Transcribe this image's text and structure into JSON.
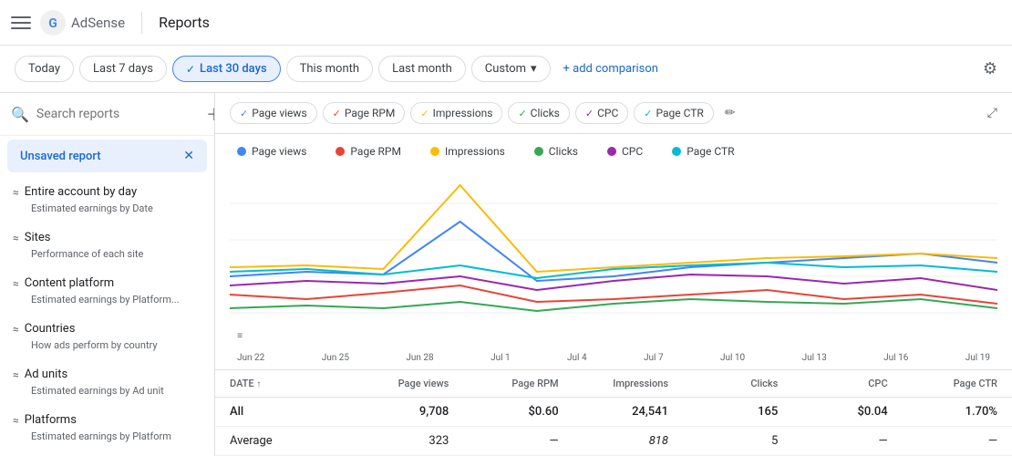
{
  "header": {
    "menu_icon": "☰",
    "logo_alt": "Google AdSense",
    "divider": true,
    "page_title": "Reports"
  },
  "filters": {
    "today": "Today",
    "last7": "Last 7 days",
    "last30": "Last 30 days",
    "thismonth": "This month",
    "lastmonth": "Last month",
    "custom": "Custom",
    "custom_arrow": "▾",
    "add_comparison": "+ add comparison"
  },
  "sidebar": {
    "search_placeholder": "Search reports",
    "unsaved_label": "Unsaved report",
    "items": [
      {
        "id": "entire-account",
        "title": "Entire account by day",
        "subtitle": "Estimated earnings by Date",
        "icon": "≈"
      },
      {
        "id": "sites",
        "title": "Sites",
        "subtitle": "Performance of each site",
        "icon": "≈"
      },
      {
        "id": "content-platform",
        "title": "Content platform",
        "subtitle": "Estimated earnings by Platform...",
        "icon": "≈"
      },
      {
        "id": "countries",
        "title": "Countries",
        "subtitle": "How ads perform by country",
        "icon": "≈"
      },
      {
        "id": "ad-units",
        "title": "Ad units",
        "subtitle": "Estimated earnings by Ad unit",
        "icon": "≈"
      },
      {
        "id": "platforms",
        "title": "Platforms",
        "subtitle": "Estimated earnings by Platform",
        "icon": "≈"
      }
    ]
  },
  "metrics": {
    "chips": [
      {
        "label": "Page views",
        "color": "#4285f4",
        "active": true
      },
      {
        "label": "Page RPM",
        "color": "#ea4335",
        "active": true
      },
      {
        "label": "Impressions",
        "color": "#fbbc05",
        "active": true
      },
      {
        "label": "Clicks",
        "color": "#34a853",
        "active": true
      },
      {
        "label": "CPC",
        "color": "#9c27b0",
        "active": true
      },
      {
        "label": "Page CTR",
        "color": "#00bcd4",
        "active": true
      }
    ]
  },
  "chart": {
    "x_labels": [
      "Jun 22",
      "Jun 25",
      "Jun 28",
      "Jul 1",
      "Jul 4",
      "Jul 7",
      "Jul 10",
      "Jul 13",
      "Jul 16",
      "Jul 19"
    ],
    "legend": [
      {
        "label": "Page views",
        "color": "#4285f4"
      },
      {
        "label": "Page RPM",
        "color": "#ea4335"
      },
      {
        "label": "Impressions",
        "color": "#fbbc05"
      },
      {
        "label": "Clicks",
        "color": "#34a853"
      },
      {
        "label": "CPC",
        "color": "#9c27b0"
      },
      {
        "label": "Page CTR",
        "color": "#00bcd4"
      }
    ]
  },
  "table": {
    "headers": [
      "DATE",
      "Page views",
      "Page RPM",
      "Impressions",
      "Clicks",
      "CPC",
      "Page CTR"
    ],
    "rows": [
      {
        "date": "All",
        "pageviews": "9,708",
        "pagerpm": "$0.60",
        "impressions": "24,541",
        "clicks": "165",
        "cpc": "$0.04",
        "pagectr": "1.70%"
      },
      {
        "date": "Average",
        "pageviews": "323",
        "pagerpm": "—",
        "impressions": "818",
        "clicks": "5",
        "cpc": "—",
        "pagectr": "—"
      }
    ]
  },
  "colors": {
    "active_bg": "#e8f0fe",
    "active_text": "#1967d2",
    "brand_blue": "#4285f4"
  }
}
